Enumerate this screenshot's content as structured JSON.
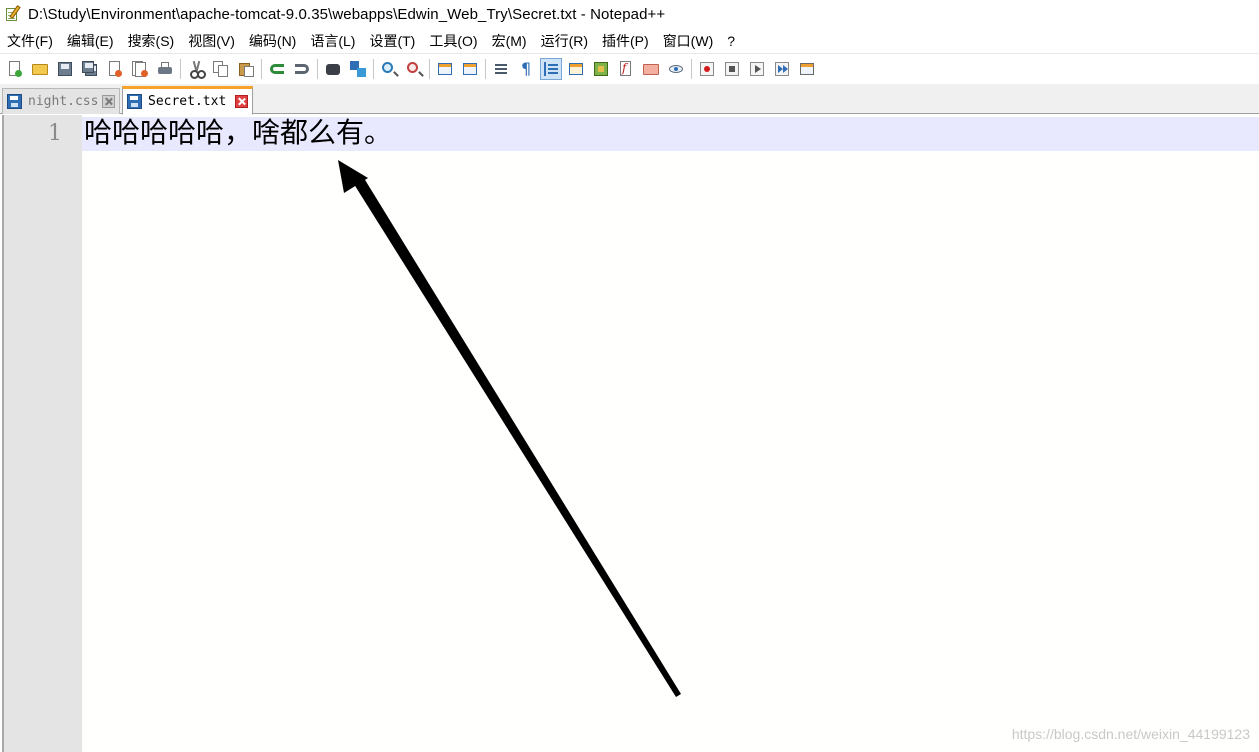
{
  "window": {
    "title": "D:\\Study\\Environment\\apache-tomcat-9.0.35\\webapps\\Edwin_Web_Try\\Secret.txt - Notepad++"
  },
  "menu": [
    {
      "label": "文件(F)"
    },
    {
      "label": "编辑(E)"
    },
    {
      "label": "搜索(S)"
    },
    {
      "label": "视图(V)"
    },
    {
      "label": "编码(N)"
    },
    {
      "label": "语言(L)"
    },
    {
      "label": "设置(T)"
    },
    {
      "label": "工具(O)"
    },
    {
      "label": "宏(M)"
    },
    {
      "label": "运行(R)"
    },
    {
      "label": "插件(P)"
    },
    {
      "label": "窗口(W)"
    },
    {
      "label": "?"
    }
  ],
  "toolbar": {
    "icons": [
      "new-file-icon",
      "open-folder-icon",
      "save-icon",
      "save-all-icon",
      "close-icon",
      "close-all-icon",
      "print-icon",
      "cut-icon",
      "copy-icon",
      "paste-icon",
      "undo-icon",
      "redo-icon",
      "find-icon",
      "replace-icon",
      "zoom-in-icon",
      "zoom-out-icon",
      "sync-vertical-icon",
      "sync-horizontal-icon",
      "word-wrap-icon",
      "show-all-chars-icon",
      "indent-guide-icon",
      "user-lang-icon",
      "document-map-icon",
      "function-list-icon",
      "folder-workspace-icon",
      "monitoring-icon",
      "record-macro-icon",
      "stop-macro-icon",
      "play-macro-icon",
      "run-macro-multiple-icon",
      "save-macro-icon"
    ]
  },
  "tabs": [
    {
      "label": "night.css",
      "active": false
    },
    {
      "label": "Secret.txt",
      "active": true
    }
  ],
  "editor": {
    "line_number": "1",
    "content": "哈哈哈哈哈，啥都么有。"
  },
  "watermark": "https://blog.csdn.net/weixin_44199123",
  "colors": {
    "active_tab_accent": "#f7a32b",
    "current_line": "#e8e8ff",
    "gutter": "#e4e4e4"
  }
}
